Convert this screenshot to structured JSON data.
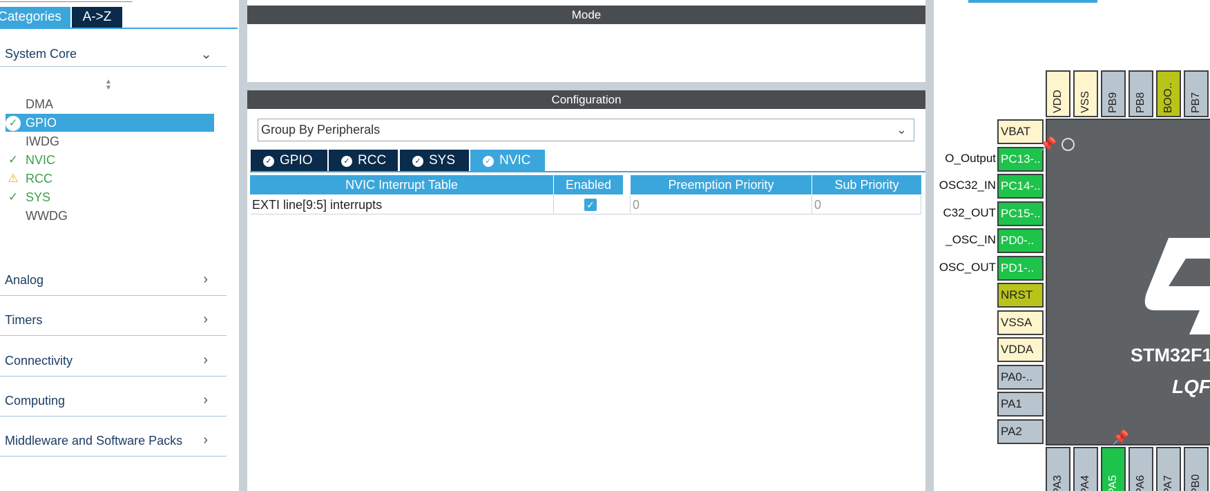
{
  "left": {
    "tab_categories": "Categories",
    "tab_az": "A->Z",
    "system_core": "System Core",
    "peripherals": [
      {
        "label": "DMA",
        "status": "none"
      },
      {
        "label": "GPIO",
        "status": "selected-ok"
      },
      {
        "label": "IWDG",
        "status": "none"
      },
      {
        "label": "NVIC",
        "status": "ok"
      },
      {
        "label": "RCC",
        "status": "warning"
      },
      {
        "label": "SYS",
        "status": "ok"
      },
      {
        "label": "WWDG",
        "status": "none"
      }
    ],
    "categories": [
      "Analog",
      "Timers",
      "Connectivity",
      "Computing",
      "Middleware and Software Packs"
    ],
    "chevron_down": "⌄",
    "chevron_right": "›"
  },
  "center": {
    "mode_title": "Mode",
    "config_title": "Configuration",
    "group_by": "Group By Peripherals",
    "tabs": [
      "GPIO",
      "RCC",
      "SYS",
      "NVIC"
    ],
    "active_tab": "NVIC",
    "table": {
      "headers": [
        "NVIC Interrupt Table",
        "Enabled",
        "Preemption Priority",
        "Sub Priority"
      ],
      "rows": [
        {
          "name": "EXTI line[9:5] interrupts",
          "enabled": true,
          "preemption": "0",
          "sub": "0"
        }
      ]
    }
  },
  "chip": {
    "brand": "STM32F1",
    "package": "LQF",
    "left_pins": [
      {
        "label": "VBAT",
        "color": "cream",
        "signal": ""
      },
      {
        "label": "PC13-..",
        "color": "green",
        "signal": "O_Output"
      },
      {
        "label": "PC14-..",
        "color": "green",
        "signal": "OSC32_IN"
      },
      {
        "label": "PC15-..",
        "color": "green",
        "signal": "C32_OUT"
      },
      {
        "label": "PD0-..",
        "color": "green",
        "signal": "_OSC_IN"
      },
      {
        "label": "PD1-..",
        "color": "green",
        "signal": "OSC_OUT"
      },
      {
        "label": "NRST",
        "color": "olive",
        "signal": ""
      },
      {
        "label": "VSSA",
        "color": "cream",
        "signal": ""
      },
      {
        "label": "VDDA",
        "color": "cream",
        "signal": ""
      },
      {
        "label": "PA0-..",
        "color": "gray",
        "signal": ""
      },
      {
        "label": "PA1",
        "color": "gray",
        "signal": ""
      },
      {
        "label": "PA2",
        "color": "gray",
        "signal": ""
      }
    ],
    "top_pins": [
      {
        "label": "VDD",
        "color": "cream"
      },
      {
        "label": "VSS",
        "color": "cream"
      },
      {
        "label": "PB9",
        "color": "gray"
      },
      {
        "label": "PB8",
        "color": "gray"
      },
      {
        "label": "BOO..",
        "color": "olive"
      },
      {
        "label": "PB7",
        "color": "gray"
      }
    ],
    "bottom_pins": [
      {
        "label": "PA3",
        "color": "gray"
      },
      {
        "label": "PA4",
        "color": "gray"
      },
      {
        "label": "PA5",
        "color": "green"
      },
      {
        "label": "PA6",
        "color": "gray"
      },
      {
        "label": "PA7",
        "color": "gray"
      },
      {
        "label": "PB0",
        "color": "gray"
      }
    ]
  }
}
